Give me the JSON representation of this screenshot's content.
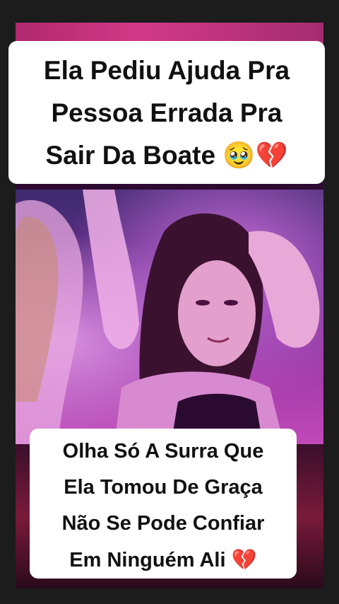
{
  "top_caption": {
    "line1": "Ela Pediu Ajuda Pra",
    "line2": "Pessoa Errada Pra",
    "line3": "Sair Da Boate",
    "emoji1": "🥹",
    "emoji2": "💔"
  },
  "bottom_caption": {
    "line1": "Olha Só A Surra Que",
    "line2": "Ela Tomou De Graça",
    "line3": "Não Se Pode Confiar",
    "line4": "Em Ninguém Ali",
    "emoji": "💔"
  },
  "colors": {
    "background": "#1c1c1c",
    "caption_background": "#ffffff",
    "caption_text": "#111111",
    "accent_pink": "#d23a86",
    "broken_heart": "#d81f3a"
  }
}
